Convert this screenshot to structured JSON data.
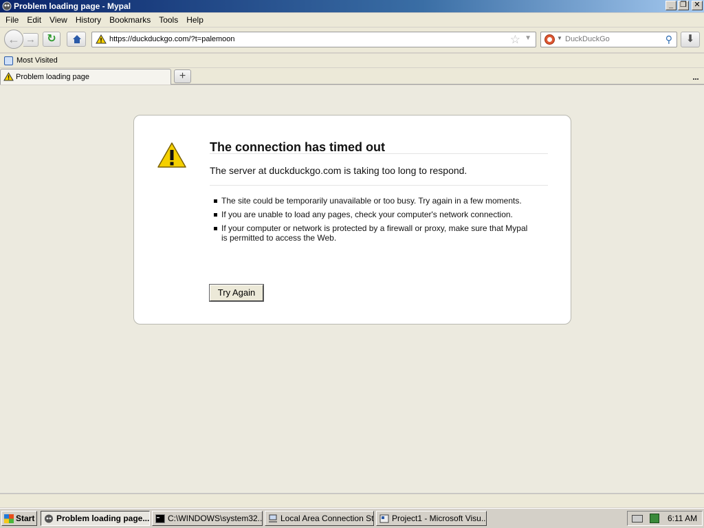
{
  "window": {
    "title": "Problem loading page - Mypal",
    "controls": {
      "minimize": "_",
      "maximize": "❐",
      "close": "✕"
    }
  },
  "menu": [
    "File",
    "Edit",
    "View",
    "History",
    "Bookmarks",
    "Tools",
    "Help"
  ],
  "toolbar": {
    "url": "https://duckduckgo.com/?t=palemoon",
    "search_engine": "DuckDuckGo",
    "search_placeholder": "DuckDuckGo"
  },
  "bookmarks": {
    "most_visited": "Most Visited"
  },
  "tabs": [
    {
      "title": "Problem loading page",
      "icon": "warning-icon"
    }
  ],
  "error": {
    "title": "The connection has timed out",
    "description": "The server at duckduckgo.com is taking too long to respond.",
    "suggestions": [
      "The site could be temporarily unavailable or too busy. Try again in a few moments.",
      "If you are unable to load any pages, check your computer's network connection.",
      "If your computer or network is protected by a firewall or proxy, make sure that Mypal is permitted to access the Web."
    ],
    "button": "Try Again"
  },
  "taskbar": {
    "start": "Start",
    "tasks": [
      {
        "label": "Problem loading page...",
        "icon": "mypal-icon",
        "active": true
      },
      {
        "label": "C:\\WINDOWS\\system32...",
        "icon": "cmd-icon",
        "active": false
      },
      {
        "label": "Local Area Connection St...",
        "icon": "network-icon",
        "active": false
      },
      {
        "label": "Project1 - Microsoft Visu...",
        "icon": "vb-icon",
        "active": false
      }
    ],
    "clock": "6:11 AM"
  },
  "colors": {
    "titlebar": "#0a246a",
    "content_bg": "#eceadf",
    "warning": "#f5d000"
  }
}
